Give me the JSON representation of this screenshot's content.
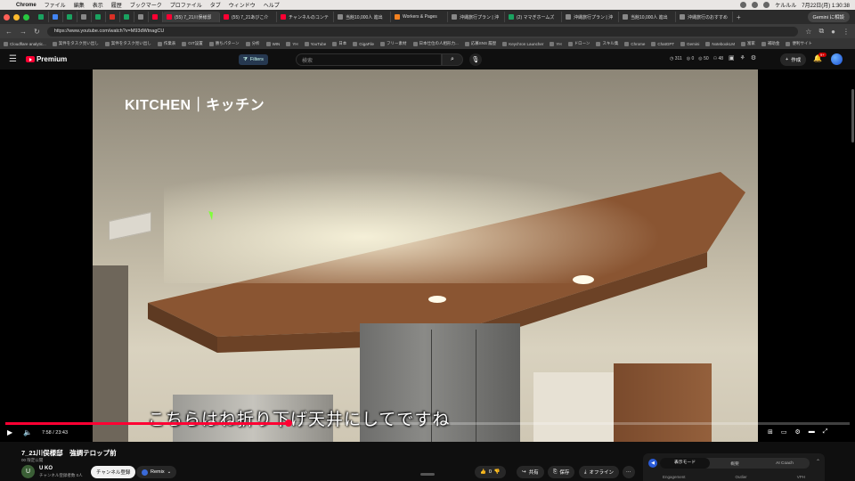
{
  "menubar": {
    "app": "Chrome",
    "items": [
      "ファイル",
      "編集",
      "表示",
      "履歴",
      "ブックマーク",
      "プロファイル",
      "タブ",
      "ウィンドウ",
      "ヘルプ"
    ],
    "clock": "7月22日(月) 1:30:38",
    "user": "ケルルル"
  },
  "tabs": [
    {
      "label": "",
      "color": "#1aa260"
    },
    {
      "label": "",
      "color": "#4285f4"
    },
    {
      "label": "",
      "color": "#1aa260"
    },
    {
      "label": "",
      "color": "#888"
    },
    {
      "label": "",
      "color": "#1aa260"
    },
    {
      "label": "",
      "color": "#d93025"
    },
    {
      "label": "",
      "color": "#1aa260"
    },
    {
      "label": "",
      "color": "#888"
    },
    {
      "label": "",
      "color": "#ff0033"
    },
    {
      "label": "(55) 7_21川俣様邸",
      "color": "#ff0033",
      "active": true
    },
    {
      "label": "(55) 7_21あびこ介",
      "color": "#ff0033"
    },
    {
      "label": "チャンネルのコンテ",
      "color": "#ff0033"
    },
    {
      "label": "当館10,000人 進出",
      "color": "#888"
    },
    {
      "label": "Workers & Pages",
      "color": "#f48120"
    },
    {
      "label": "沖縄旅行プラン | 沖",
      "color": "#888"
    },
    {
      "label": "(2) ママぎホームズ",
      "color": "#1aa260"
    },
    {
      "label": "沖縄旅行プラン | 沖",
      "color": "#888"
    },
    {
      "label": "当館10,000人 進出",
      "color": "#888"
    },
    {
      "label": "沖縄旅行のおすすめ",
      "color": "#888"
    }
  ],
  "gemini_label": "Gemini に相談",
  "url": "https://www.youtube.com/watch?v=M93dWtnagCU",
  "bookmarks": [
    "Cloudflare analytic...",
    "案件をタスク見い出し",
    "案件をタスク見い出し",
    "作業表",
    "GIT設置",
    "勝ちパターン",
    "分析",
    "WIN",
    "YH",
    "YouTube",
    "日本",
    "GigaFile",
    "フリー素材",
    "日本仕位の人相形力...",
    "応募SNS 履歴",
    "Keychron Launcher",
    "YH",
    "ドローン",
    "スキル集",
    "Chrome",
    "ChatGPT",
    "Gemini",
    "NotebookLM",
    "富家",
    "補助金",
    "便利サイト"
  ],
  "header": {
    "brand": "Premium",
    "filters": "Filters",
    "search_placeholder": "検索",
    "stats": [
      "311",
      "0",
      "50",
      "48"
    ],
    "create": "作成",
    "notif_count": "9+"
  },
  "video": {
    "overlay_title": "KITCHEN｜キッチン",
    "subtitle": "こちらはね折り下げ天井にしてですね",
    "time": "7:58 / 23:43",
    "progress": 0.335
  },
  "info": {
    "title": "7_21川俣様邸　強調テロップ前",
    "meta": "00 限定公開",
    "channel": "U KO",
    "channel_initial": "U",
    "subs": "チャンネル登録者数 0人",
    "subscribe": "チャンネル登録",
    "remix": "Remix",
    "likes": "0",
    "share": "共有",
    "save": "保存",
    "offline": "オフライン"
  },
  "panel": {
    "tabs": [
      "表示モード",
      "概要",
      "AI Coach"
    ],
    "labels": [
      "Engagement",
      "Outlier",
      "VPH"
    ]
  }
}
